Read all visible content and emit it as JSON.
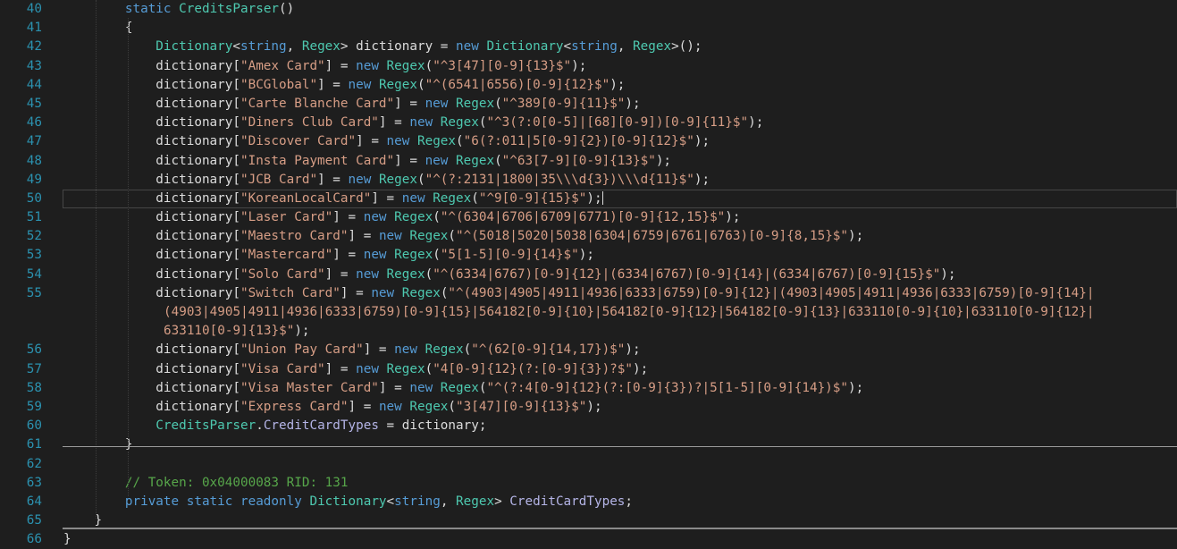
{
  "editor": {
    "current_line": "50",
    "lines": [
      {
        "num": "40",
        "indent": 8,
        "segs": [
          [
            "k",
            "static "
          ],
          [
            "m",
            "CreditsParser"
          ],
          [
            "p",
            "()"
          ]
        ]
      },
      {
        "num": "41",
        "indent": 8,
        "segs": [
          [
            "p",
            "{"
          ]
        ]
      },
      {
        "num": "42",
        "indent": 12,
        "segs": [
          [
            "t",
            "Dictionary"
          ],
          [
            "p",
            "<"
          ],
          [
            "k",
            "string"
          ],
          [
            "p",
            ", "
          ],
          [
            "t",
            "Regex"
          ],
          [
            "p",
            "> dictionary = "
          ],
          [
            "k",
            "new "
          ],
          [
            "t",
            "Dictionary"
          ],
          [
            "p",
            "<"
          ],
          [
            "k",
            "string"
          ],
          [
            "p",
            ", "
          ],
          [
            "t",
            "Regex"
          ],
          [
            "p",
            ">();"
          ]
        ]
      },
      {
        "num": "43",
        "indent": 12,
        "segs": [
          [
            "p",
            "dictionary["
          ],
          [
            "s",
            "\"Amex Card\""
          ],
          [
            "p",
            "] = "
          ],
          [
            "k",
            "new "
          ],
          [
            "t",
            "Regex"
          ],
          [
            "p",
            "("
          ],
          [
            "s",
            "\"^3[47][0-9]{13}$\""
          ],
          [
            "p",
            ");"
          ]
        ]
      },
      {
        "num": "44",
        "indent": 12,
        "segs": [
          [
            "p",
            "dictionary["
          ],
          [
            "s",
            "\"BCGlobal\""
          ],
          [
            "p",
            "] = "
          ],
          [
            "k",
            "new "
          ],
          [
            "t",
            "Regex"
          ],
          [
            "p",
            "("
          ],
          [
            "s",
            "\"^(6541|6556)[0-9]{12}$\""
          ],
          [
            "p",
            ");"
          ]
        ]
      },
      {
        "num": "45",
        "indent": 12,
        "segs": [
          [
            "p",
            "dictionary["
          ],
          [
            "s",
            "\"Carte Blanche Card\""
          ],
          [
            "p",
            "] = "
          ],
          [
            "k",
            "new "
          ],
          [
            "t",
            "Regex"
          ],
          [
            "p",
            "("
          ],
          [
            "s",
            "\"^389[0-9]{11}$\""
          ],
          [
            "p",
            ");"
          ]
        ]
      },
      {
        "num": "46",
        "indent": 12,
        "segs": [
          [
            "p",
            "dictionary["
          ],
          [
            "s",
            "\"Diners Club Card\""
          ],
          [
            "p",
            "] = "
          ],
          [
            "k",
            "new "
          ],
          [
            "t",
            "Regex"
          ],
          [
            "p",
            "("
          ],
          [
            "s",
            "\"^3(?:0[0-5]|[68][0-9])[0-9]{11}$\""
          ],
          [
            "p",
            ");"
          ]
        ]
      },
      {
        "num": "47",
        "indent": 12,
        "segs": [
          [
            "p",
            "dictionary["
          ],
          [
            "s",
            "\"Discover Card\""
          ],
          [
            "p",
            "] = "
          ],
          [
            "k",
            "new "
          ],
          [
            "t",
            "Regex"
          ],
          [
            "p",
            "("
          ],
          [
            "s",
            "\"6(?:011|5[0-9]{2})[0-9]{12}$\""
          ],
          [
            "p",
            ");"
          ]
        ]
      },
      {
        "num": "48",
        "indent": 12,
        "segs": [
          [
            "p",
            "dictionary["
          ],
          [
            "s",
            "\"Insta Payment Card\""
          ],
          [
            "p",
            "] = "
          ],
          [
            "k",
            "new "
          ],
          [
            "t",
            "Regex"
          ],
          [
            "p",
            "("
          ],
          [
            "s",
            "\"^63[7-9][0-9]{13}$\""
          ],
          [
            "p",
            ");"
          ]
        ]
      },
      {
        "num": "49",
        "indent": 12,
        "segs": [
          [
            "p",
            "dictionary["
          ],
          [
            "s",
            "\"JCB Card\""
          ],
          [
            "p",
            "] = "
          ],
          [
            "k",
            "new "
          ],
          [
            "t",
            "Regex"
          ],
          [
            "p",
            "("
          ],
          [
            "s",
            "\"^(?:2131|1800|35\\\\\\d{3})\\\\\\d{11}$\""
          ],
          [
            "p",
            ");"
          ]
        ]
      },
      {
        "num": "50",
        "indent": 12,
        "segs": [
          [
            "p",
            "dictionary["
          ],
          [
            "s",
            "\"KoreanLocalCard\""
          ],
          [
            "p",
            "] = "
          ],
          [
            "k",
            "new "
          ],
          [
            "t",
            "Regex"
          ],
          [
            "p",
            "("
          ],
          [
            "s",
            "\"^9[0-9]{15}$\""
          ],
          [
            "p",
            ");"
          ]
        ]
      },
      {
        "num": "51",
        "indent": 12,
        "segs": [
          [
            "p",
            "dictionary["
          ],
          [
            "s",
            "\"Laser Card\""
          ],
          [
            "p",
            "] = "
          ],
          [
            "k",
            "new "
          ],
          [
            "t",
            "Regex"
          ],
          [
            "p",
            "("
          ],
          [
            "s",
            "\"^(6304|6706|6709|6771)[0-9]{12,15}$\""
          ],
          [
            "p",
            ");"
          ]
        ]
      },
      {
        "num": "52",
        "indent": 12,
        "segs": [
          [
            "p",
            "dictionary["
          ],
          [
            "s",
            "\"Maestro Card\""
          ],
          [
            "p",
            "] = "
          ],
          [
            "k",
            "new "
          ],
          [
            "t",
            "Regex"
          ],
          [
            "p",
            "("
          ],
          [
            "s",
            "\"^(5018|5020|5038|6304|6759|6761|6763)[0-9]{8,15}$\""
          ],
          [
            "p",
            ");"
          ]
        ]
      },
      {
        "num": "53",
        "indent": 12,
        "segs": [
          [
            "p",
            "dictionary["
          ],
          [
            "s",
            "\"Mastercard\""
          ],
          [
            "p",
            "] = "
          ],
          [
            "k",
            "new "
          ],
          [
            "t",
            "Regex"
          ],
          [
            "p",
            "("
          ],
          [
            "s",
            "\"5[1-5][0-9]{14}$\""
          ],
          [
            "p",
            ");"
          ]
        ]
      },
      {
        "num": "54",
        "indent": 12,
        "segs": [
          [
            "p",
            "dictionary["
          ],
          [
            "s",
            "\"Solo Card\""
          ],
          [
            "p",
            "] = "
          ],
          [
            "k",
            "new "
          ],
          [
            "t",
            "Regex"
          ],
          [
            "p",
            "("
          ],
          [
            "s",
            "\"^(6334|6767)[0-9]{12}|(6334|6767)[0-9]{14}|(6334|6767)[0-9]{15}$\""
          ],
          [
            "p",
            ");"
          ]
        ]
      },
      {
        "num": "55",
        "indent": 12,
        "segs": [
          [
            "p",
            "dictionary["
          ],
          [
            "s",
            "\"Switch Card\""
          ],
          [
            "p",
            "] = "
          ],
          [
            "k",
            "new "
          ],
          [
            "t",
            "Regex"
          ],
          [
            "p",
            "("
          ],
          [
            "s",
            "\"^(4903|4905|4911|4936|6333|6759)[0-9]{12}|(4903|4905|4911|4936|6333|6759)[0-9]{14}|"
          ]
        ]
      },
      {
        "num": "",
        "wrap": true,
        "indent": 0,
        "segs": [
          [
            "s",
            "(4903|4905|4911|4936|6333|6759)[0-9]{15}|564182[0-9]{10}|564182[0-9]{12}|564182[0-9]{13}|633110[0-9]{10}|633110[0-9]{12}|"
          ]
        ]
      },
      {
        "num": "",
        "wrap": true,
        "indent": 0,
        "segs": [
          [
            "s",
            "633110[0-9]{13}$\""
          ],
          [
            "p",
            ");"
          ]
        ]
      },
      {
        "num": "56",
        "indent": 12,
        "segs": [
          [
            "p",
            "dictionary["
          ],
          [
            "s",
            "\"Union Pay Card\""
          ],
          [
            "p",
            "] = "
          ],
          [
            "k",
            "new "
          ],
          [
            "t",
            "Regex"
          ],
          [
            "p",
            "("
          ],
          [
            "s",
            "\"^(62[0-9]{14,17})$\""
          ],
          [
            "p",
            ");"
          ]
        ]
      },
      {
        "num": "57",
        "indent": 12,
        "segs": [
          [
            "p",
            "dictionary["
          ],
          [
            "s",
            "\"Visa Card\""
          ],
          [
            "p",
            "] = "
          ],
          [
            "k",
            "new "
          ],
          [
            "t",
            "Regex"
          ],
          [
            "p",
            "("
          ],
          [
            "s",
            "\"4[0-9]{12}(?:[0-9]{3})?$\""
          ],
          [
            "p",
            ");"
          ]
        ]
      },
      {
        "num": "58",
        "indent": 12,
        "segs": [
          [
            "p",
            "dictionary["
          ],
          [
            "s",
            "\"Visa Master Card\""
          ],
          [
            "p",
            "] = "
          ],
          [
            "k",
            "new "
          ],
          [
            "t",
            "Regex"
          ],
          [
            "p",
            "("
          ],
          [
            "s",
            "\"^(?:4[0-9]{12}(?:[0-9]{3})?|5[1-5][0-9]{14})$\""
          ],
          [
            "p",
            ");"
          ]
        ]
      },
      {
        "num": "59",
        "indent": 12,
        "segs": [
          [
            "p",
            "dictionary["
          ],
          [
            "s",
            "\"Express Card\""
          ],
          [
            "p",
            "] = "
          ],
          [
            "k",
            "new "
          ],
          [
            "t",
            "Regex"
          ],
          [
            "p",
            "("
          ],
          [
            "s",
            "\"3[47][0-9]{13}$\""
          ],
          [
            "p",
            ");"
          ]
        ]
      },
      {
        "num": "60",
        "indent": 12,
        "segs": [
          [
            "m",
            "CreditsParser"
          ],
          [
            "p",
            "."
          ],
          [
            "f",
            "CreditCardTypes"
          ],
          [
            "p",
            " = dictionary;"
          ]
        ]
      },
      {
        "num": "61",
        "indent": 8,
        "segs": [
          [
            "p",
            "}"
          ]
        ]
      },
      {
        "num": "62",
        "indent": 0,
        "segs": []
      },
      {
        "num": "63",
        "indent": 8,
        "segs": [
          [
            "c",
            "// Token: 0x04000083 RID: 131"
          ]
        ]
      },
      {
        "num": "64",
        "indent": 8,
        "segs": [
          [
            "k",
            "private static readonly "
          ],
          [
            "t",
            "Dictionary"
          ],
          [
            "p",
            "<"
          ],
          [
            "k",
            "string"
          ],
          [
            "p",
            ", "
          ],
          [
            "t",
            "Regex"
          ],
          [
            "p",
            "> "
          ],
          [
            "f",
            "CreditCardTypes"
          ],
          [
            "p",
            ";"
          ]
        ]
      },
      {
        "num": "65",
        "indent": 4,
        "segs": [
          [
            "p",
            "}"
          ]
        ]
      },
      {
        "num": "66",
        "indent": 0,
        "segs": [
          [
            "p",
            "}"
          ]
        ]
      }
    ]
  },
  "colors": {
    "background": "#1e1e1e",
    "keyword": "#569cd6",
    "type": "#4ec9b0",
    "string": "#d69d85",
    "comment": "#57a64a",
    "line_number": "#2b91af"
  }
}
